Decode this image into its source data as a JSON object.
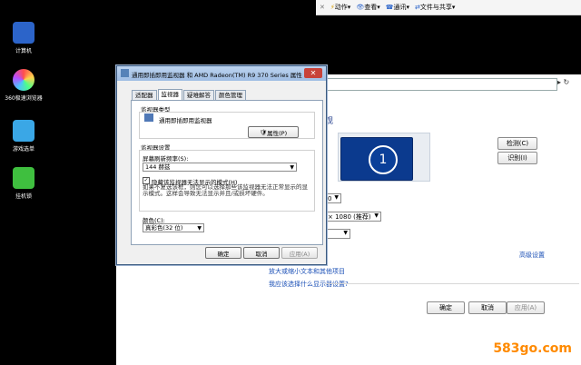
{
  "desktop": {
    "icons": [
      {
        "label": "计算机",
        "icon": "computer-icon"
      },
      {
        "label": "360极速浏览器",
        "icon": "360-browser-icon"
      },
      {
        "label": "游戏选单",
        "icon": "game-menu-icon"
      },
      {
        "label": "挂机锁",
        "icon": "lock-icon"
      }
    ]
  },
  "topbar": {
    "items": [
      "动作",
      "查看",
      "通讯",
      "文件与共享"
    ]
  },
  "main": {
    "heading": "观",
    "detect_label": "检测(C)",
    "identify_label": "识别(I)",
    "resolution_value": "× 1080 (推荐)",
    "select_small_1": "0",
    "advanced_link": "高级设置",
    "link1": "放大或缩小文本和其他项目",
    "link2": "我应该选择什么显示器设置?",
    "ok_label": "确定",
    "cancel_label": "取消",
    "apply_label": "应用(A)",
    "monitor_number": "1"
  },
  "dialog": {
    "title": "通用即插即用监视器 和 AMD Radeon(TM) R9 370 Series 属性",
    "close": "✕",
    "tabs": [
      "适配器",
      "监视器",
      "疑难解答",
      "颜色管理"
    ],
    "active_tab": "监视器",
    "monitor_type_label": "监视器类型",
    "monitor_name": "通用即插即用监视器",
    "properties_label": "属性(P)",
    "settings_label": "监视器设置",
    "refresh_label": "屏幕刷新频率(S):",
    "refresh_value": "144 赫兹",
    "hide_modes_label": "隐藏该监视器无法显示的模式(H)",
    "hide_modes_help": "如果不复选该框，则您可以选择那些该监视器无法正常显示的显示模式。这样会导致无法显示并且/或损坏硬件。",
    "color_label": "颜色(C):",
    "color_value": "真彩色(32 位)",
    "ok_label": "确定",
    "cancel_label": "取消",
    "apply_label": "应用(A)"
  },
  "watermark": "583go.com"
}
